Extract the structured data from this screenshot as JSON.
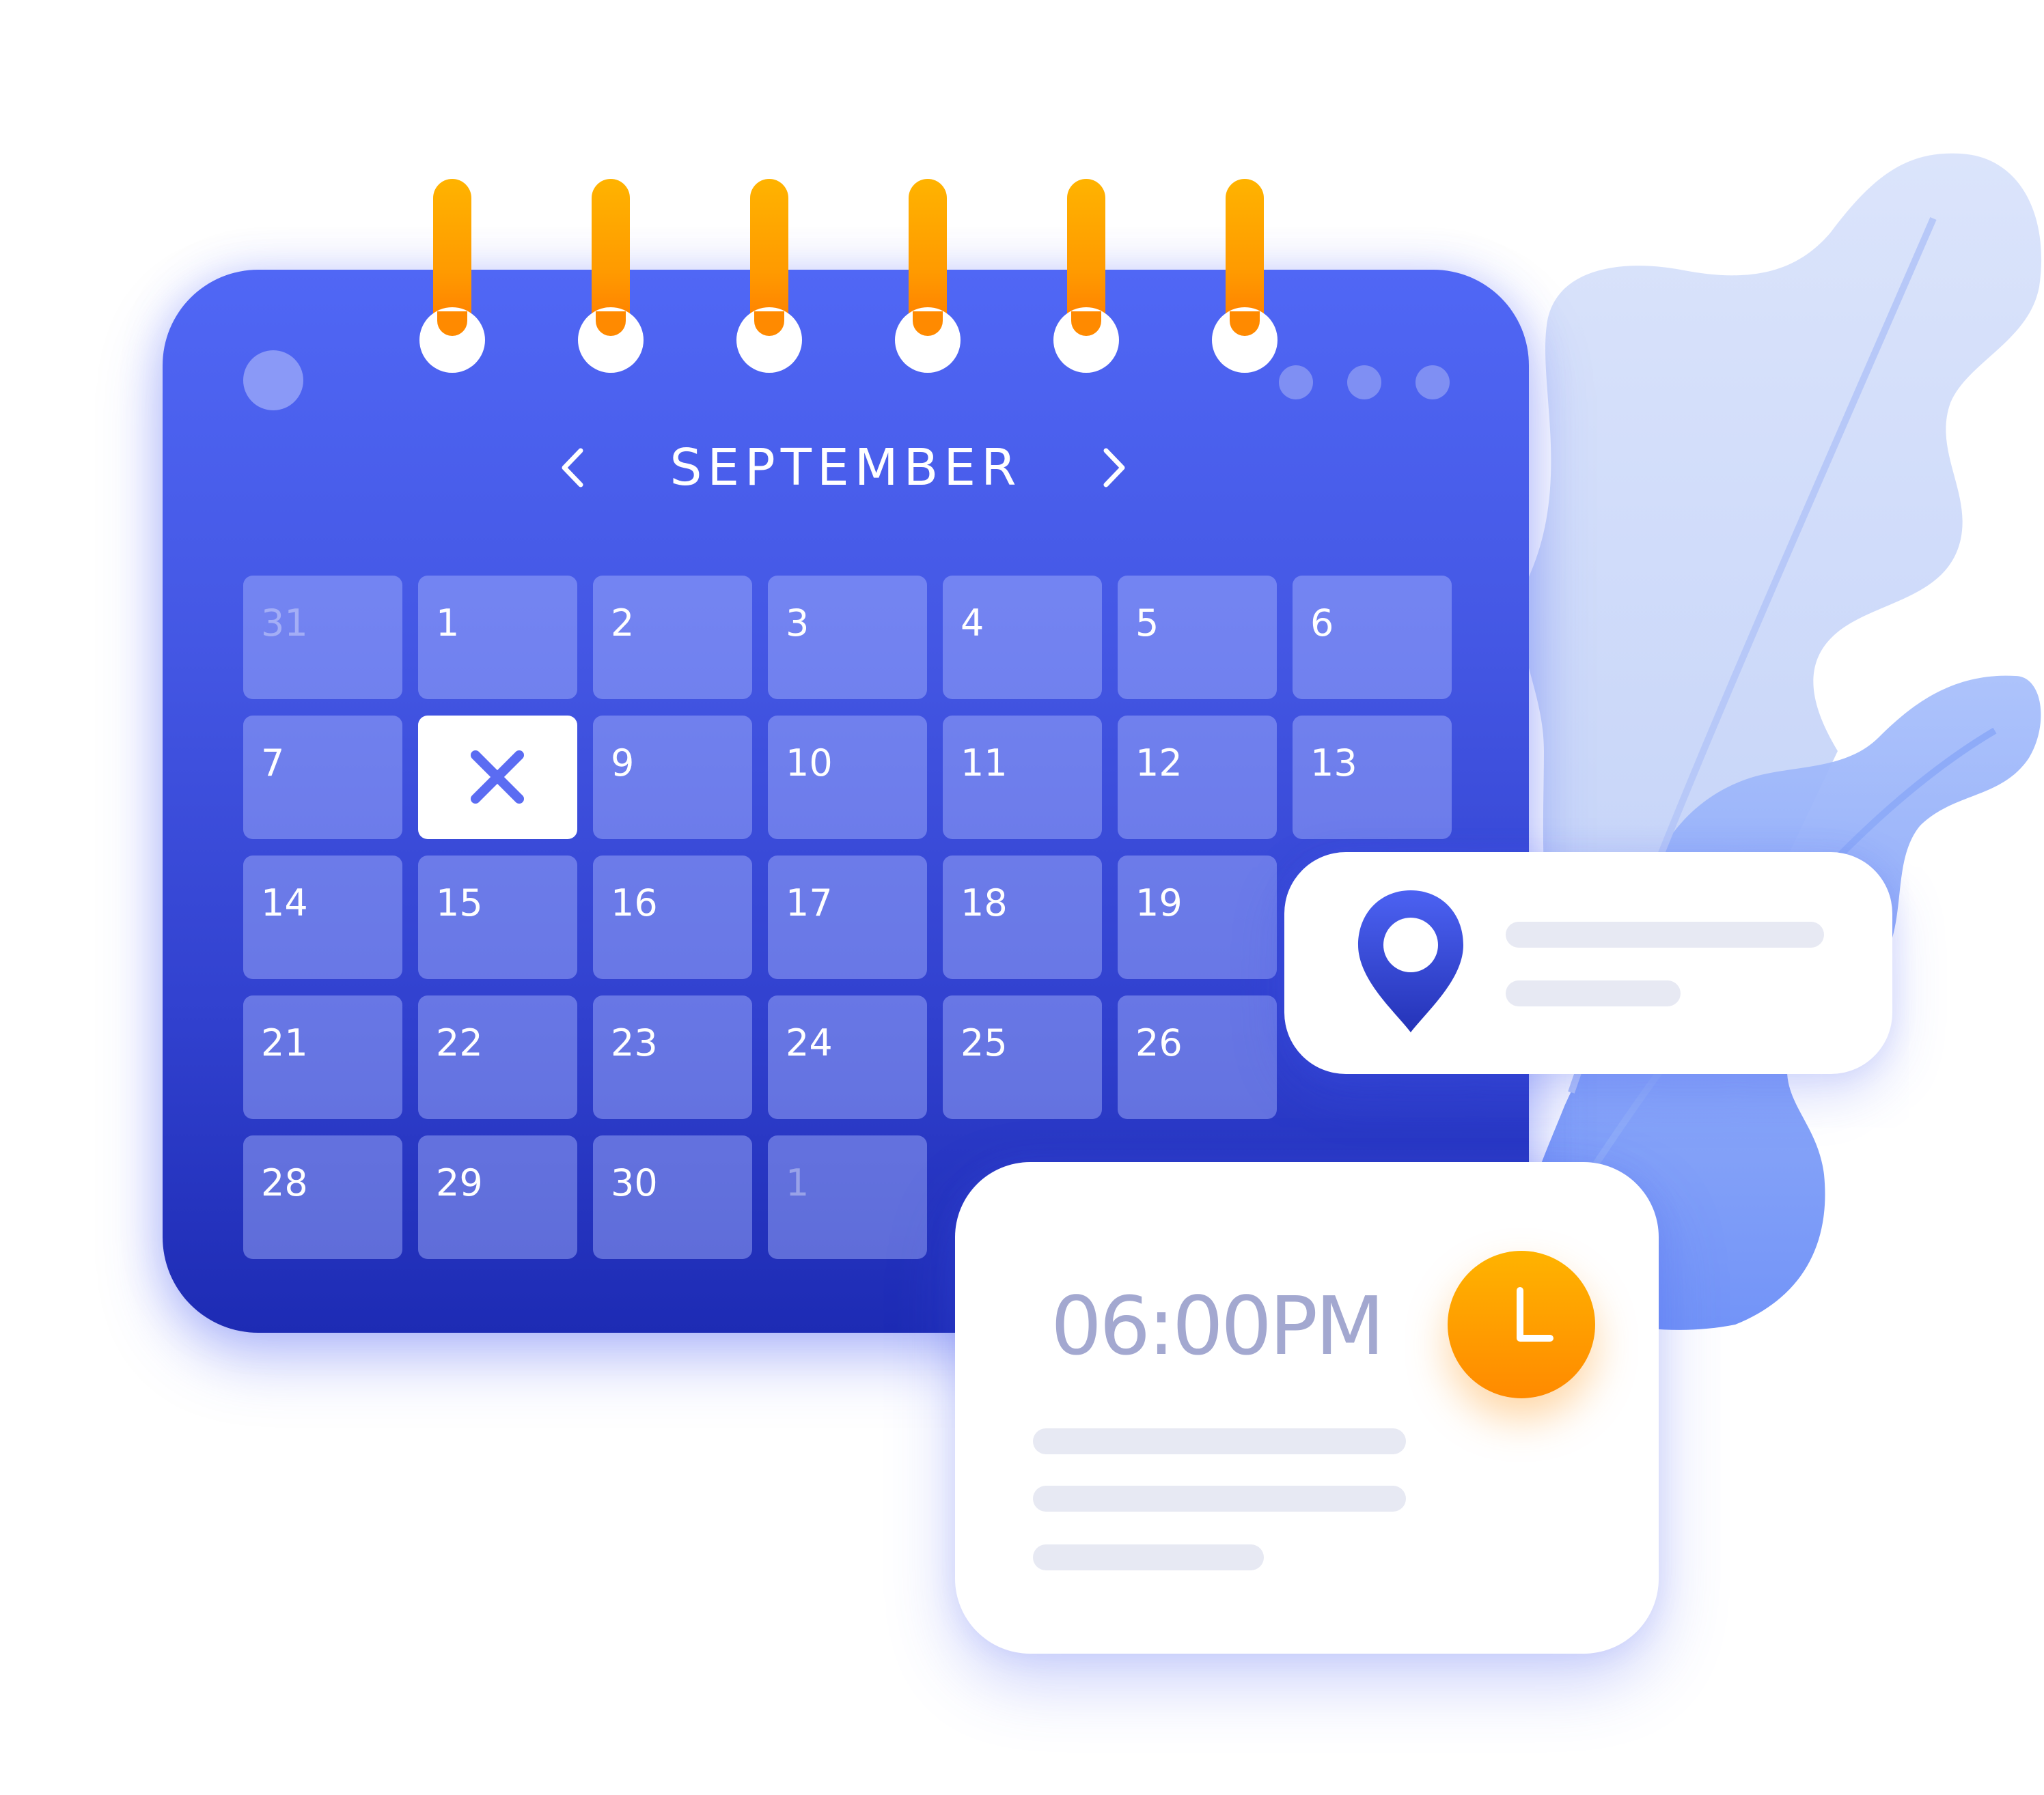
{
  "calendar": {
    "month": "SEPTEMBER",
    "prev_icon": "chevron-left-icon",
    "next_icon": "chevron-right-icon",
    "days": [
      {
        "label": "31",
        "muted": true
      },
      {
        "label": "1"
      },
      {
        "label": "2"
      },
      {
        "label": "3"
      },
      {
        "label": "4"
      },
      {
        "label": "5"
      },
      {
        "label": "6"
      },
      {
        "label": "7"
      },
      {
        "label": "",
        "selected": true,
        "icon": "close-icon"
      },
      {
        "label": "9"
      },
      {
        "label": "10"
      },
      {
        "label": "11"
      },
      {
        "label": "12"
      },
      {
        "label": "13"
      },
      {
        "label": "14"
      },
      {
        "label": "15"
      },
      {
        "label": "16"
      },
      {
        "label": "17"
      },
      {
        "label": "18"
      },
      {
        "label": "19"
      },
      {
        "label": "",
        "hidden": true
      },
      {
        "label": "21"
      },
      {
        "label": "22"
      },
      {
        "label": "23"
      },
      {
        "label": "24"
      },
      {
        "label": "25"
      },
      {
        "label": "26"
      },
      {
        "label": "",
        "hidden": true
      },
      {
        "label": "28"
      },
      {
        "label": "29"
      },
      {
        "label": "30"
      },
      {
        "label": "1",
        "muted": true
      }
    ],
    "colors": {
      "primary": "#4457e4",
      "ring": "#ff9a00",
      "accent": "#5b6cf2"
    }
  },
  "location_card": {
    "icon": "map-pin-icon"
  },
  "time_card": {
    "time": "06:00PM",
    "icon": "clock-icon"
  }
}
